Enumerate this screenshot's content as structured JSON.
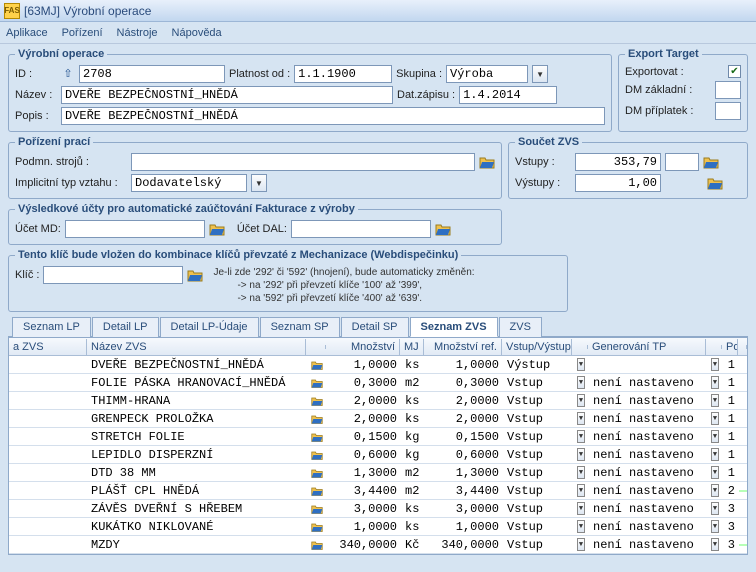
{
  "window": {
    "title": "[63MJ] Výrobní operace"
  },
  "menu": {
    "aplikace": "Aplikace",
    "porizeni": "Pořízení",
    "nastroje": "Nástroje",
    "napoveda": "Nápověda"
  },
  "op": {
    "legend": "Výrobní operace",
    "id_lbl": "ID :",
    "id": "2708",
    "platnost_lbl": "Platnost od :",
    "platnost": "1.1.1900",
    "skupina_lbl": "Skupina :",
    "skupina": "Výroba",
    "nazev_lbl": "Název :",
    "nazev": "DVEŘE BEZPEČNOSTNÍ_HNĚDÁ",
    "datzap_lbl": "Dat.zápisu :",
    "datzap": "1.4.2014",
    "popis_lbl": "Popis :",
    "popis": "DVEŘE BEZPEČNOSTNÍ_HNĚDÁ"
  },
  "export": {
    "legend": "Export Target",
    "exportovat_lbl": "Exportovat :",
    "dm_zakl_lbl": "DM základní :",
    "dm_prip_lbl": "DM příplatek :"
  },
  "pp": {
    "legend": "Pořízení prací",
    "podm_lbl": "Podmn. strojů :",
    "impl_lbl": "Implicitní typ vztahu :",
    "impl_val": "Dodavatelský"
  },
  "soucet": {
    "legend": "Součet ZVS",
    "vstupy_lbl": "Vstupy :",
    "vstupy": "353,79",
    "vystupy_lbl": "Výstupy :",
    "vystupy": "1,00"
  },
  "ucty": {
    "legend": "Výsledkové účty pro automatické zaúčtování Fakturace z výroby",
    "md_lbl": "Účet MD:",
    "dal_lbl": "Účet DAL:"
  },
  "klic": {
    "legend": "Tento klíč bude vložen do kombinace klíčů převzaté z Mechanizace (Webdispečinku)",
    "klic_lbl": "Klíč :",
    "note1": "Je-li zde '292' či '592' (hnojení), bude automaticky změněn:",
    "note2": "-> na '292' při převzetí klíče '100' až '399',",
    "note3": "-> na '592' při převzetí klíče '400' až '639'."
  },
  "tabs": {
    "seznam_lp": "Seznam LP",
    "detail_lp": "Detail LP",
    "detail_lp_udaje": "Detail LP-Údaje",
    "seznam_sp": "Seznam SP",
    "detail_sp": "Detail SP",
    "seznam_zvs": "Seznam ZVS",
    "zvs": "ZVS"
  },
  "grid": {
    "head": {
      "zvs": "a ZVS",
      "nazev": "Název ZVS",
      "mnoz": "Množství",
      "mj": "MJ",
      "ref": "Množství ref.",
      "vv": "Vstup/Výstup",
      "gen": "Generování TP",
      "por": "Poř."
    },
    "rows": [
      {
        "nazev": "DVEŘE BEZPEČNOSTNÍ_HNĚDÁ",
        "mnoz": "1,0000",
        "mj": "ks",
        "ref": "1,0000",
        "vv": "Výstup",
        "gen": "",
        "por": "1"
      },
      {
        "nazev": "FOLIE PÁSKA HRANOVACÍ_HNĚDÁ",
        "mnoz": "0,3000",
        "mj": "m2",
        "ref": "0,3000",
        "vv": "Vstup",
        "gen": "není nastaveno",
        "por": "1"
      },
      {
        "nazev": "THIMM-HRANA",
        "mnoz": "2,0000",
        "mj": "ks",
        "ref": "2,0000",
        "vv": "Vstup",
        "gen": "není nastaveno",
        "por": "1"
      },
      {
        "nazev": "GRENPECK PROLOŽKA",
        "mnoz": "2,0000",
        "mj": "ks",
        "ref": "2,0000",
        "vv": "Vstup",
        "gen": "není nastaveno",
        "por": "1"
      },
      {
        "nazev": "STRETCH FOLIE",
        "mnoz": "0,1500",
        "mj": "kg",
        "ref": "0,1500",
        "vv": "Vstup",
        "gen": "není nastaveno",
        "por": "1"
      },
      {
        "nazev": "LEPIDLO DISPERZNÍ",
        "mnoz": "0,6000",
        "mj": "kg",
        "ref": "0,6000",
        "vv": "Vstup",
        "gen": "není nastaveno",
        "por": "1"
      },
      {
        "nazev": "DTD 38 MM",
        "mnoz": "1,3000",
        "mj": "m2",
        "ref": "1,3000",
        "vv": "Vstup",
        "gen": "není nastaveno",
        "por": "1"
      },
      {
        "nazev": "PLÁŠŤ CPL HNĚDÁ",
        "mnoz": "3,4400",
        "mj": "m2",
        "ref": "3,4400",
        "vv": "Vstup",
        "gen": "není nastaveno",
        "por": "2",
        "hl": true
      },
      {
        "nazev": "ZÁVĚS DVEŘNÍ S HŘEBEM",
        "mnoz": "3,0000",
        "mj": "ks",
        "ref": "3,0000",
        "vv": "Vstup",
        "gen": "není nastaveno",
        "por": "3"
      },
      {
        "nazev": "KUKÁTKO NIKLOVANÉ",
        "mnoz": "1,0000",
        "mj": "ks",
        "ref": "1,0000",
        "vv": "Vstup",
        "gen": "není nastaveno",
        "por": "3"
      },
      {
        "nazev": "MZDY",
        "mnoz": "340,0000",
        "mj": "Kč",
        "ref": "340,0000",
        "vv": "Vstup",
        "gen": "není nastaveno",
        "por": "3",
        "hl": true
      }
    ]
  }
}
